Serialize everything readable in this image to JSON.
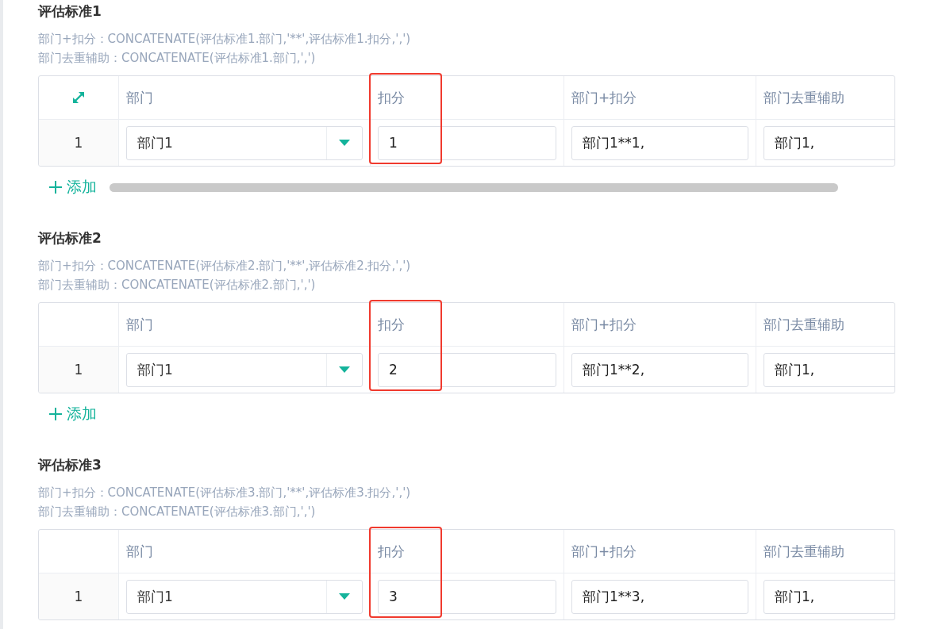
{
  "sections": [
    {
      "title": "评估标准1",
      "formulas": [
        "部门+扣分：CONCATENATE(评估标准1.部门,'**',评估标准1.扣分,',')",
        "部门去重辅助：CONCATENATE(评估标准1.部门,',')"
      ],
      "expandable": true,
      "columns": [
        "部门",
        "扣分",
        "部门+扣分",
        "部门去重辅助"
      ],
      "rows": [
        {
          "index": "1",
          "department": "部门1",
          "score": "1",
          "combined": "部门1**1,",
          "dedup": "部门1,"
        }
      ],
      "add_label": "添加",
      "scrollbar": true,
      "highlighted": true
    },
    {
      "title": "评估标准2",
      "formulas": [
        "部门+扣分：CONCATENATE(评估标准2.部门,'**',评估标准2.扣分,',')",
        "部门去重辅助：CONCATENATE(评估标准2.部门,',')"
      ],
      "columns": [
        "部门",
        "扣分",
        "部门+扣分",
        "部门去重辅助"
      ],
      "rows": [
        {
          "index": "1",
          "department": "部门1",
          "score": "2",
          "combined": "部门1**2,",
          "dedup": "部门1,"
        }
      ],
      "add_label": "添加",
      "highlighted": true
    },
    {
      "title": "评估标准3",
      "formulas": [
        "部门+扣分：CONCATENATE(评估标准3.部门,'**',评估标准3.扣分,',')",
        "部门去重辅助：CONCATENATE(评估标准3.部门,',')"
      ],
      "columns": [
        "部门",
        "扣分",
        "部门+扣分",
        "部门去重辅助"
      ],
      "rows": [
        {
          "index": "1",
          "department": "部门1",
          "score": "3",
          "combined": "部门1**3,",
          "dedup": "部门1,"
        }
      ],
      "highlighted": true
    }
  ]
}
